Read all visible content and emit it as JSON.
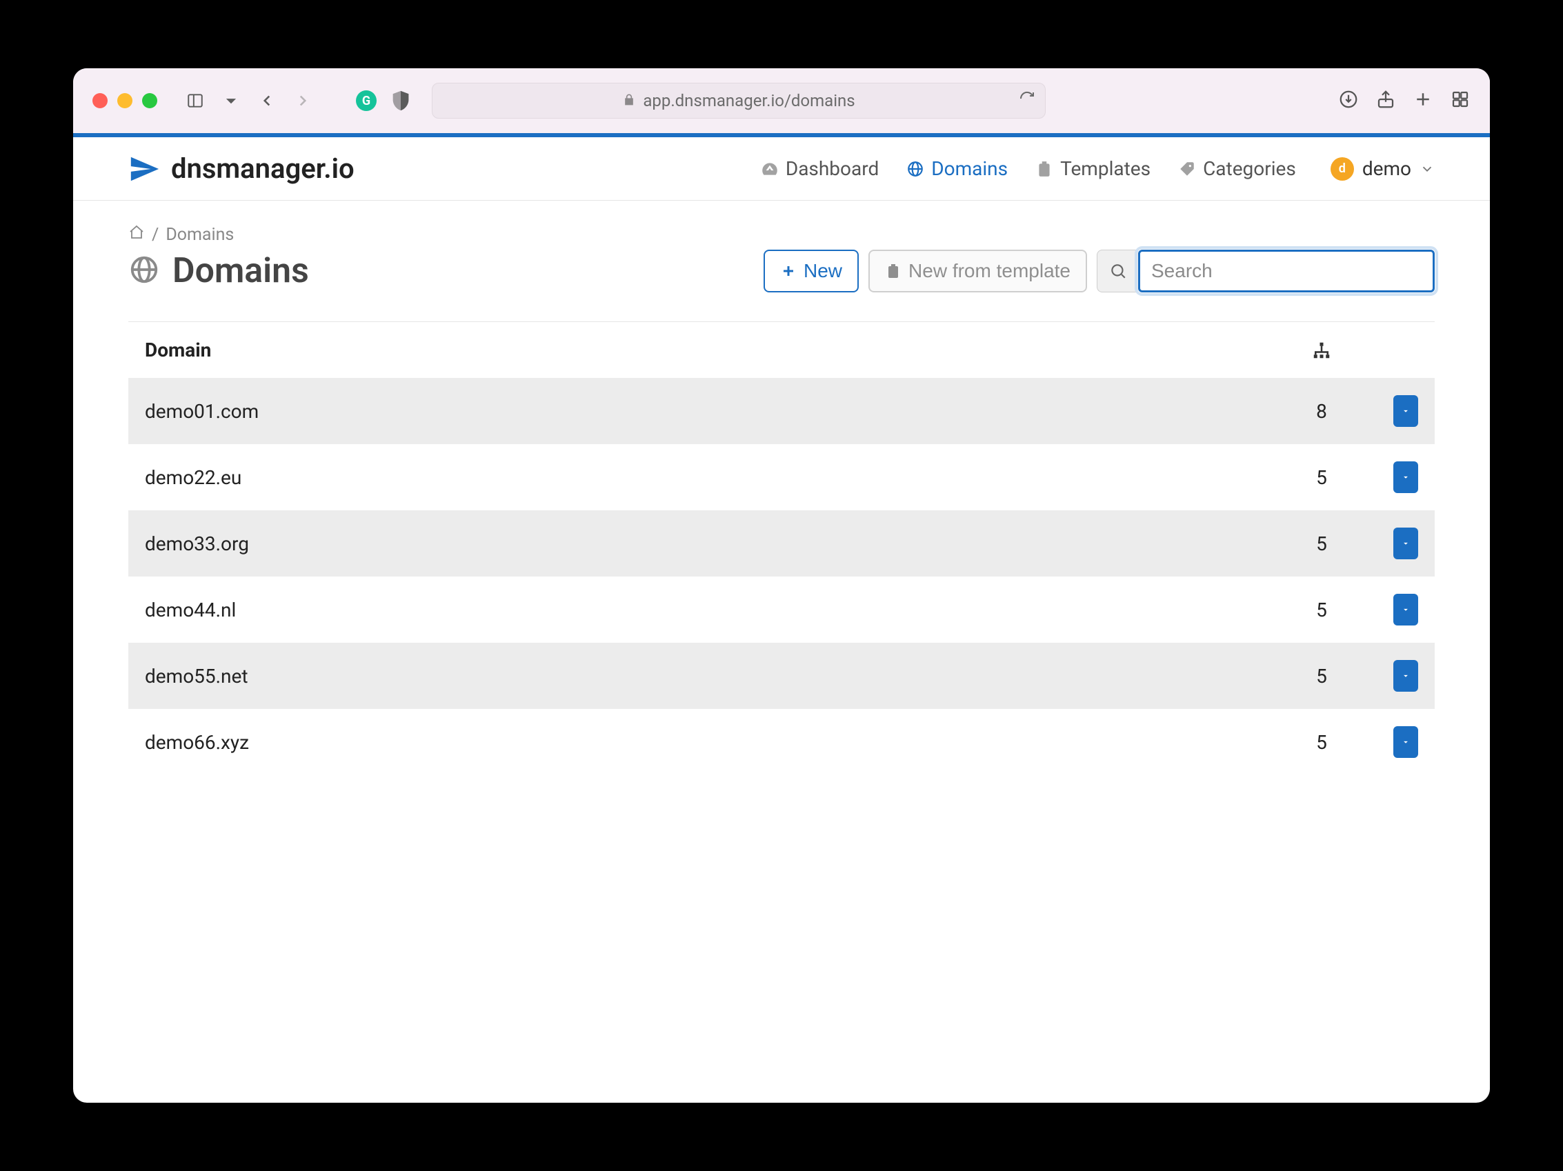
{
  "browser": {
    "url": "app.dnsmanager.io/domains"
  },
  "brand": "dnsmanager.io",
  "nav": {
    "dashboard": "Dashboard",
    "domains": "Domains",
    "templates": "Templates",
    "categories": "Categories"
  },
  "user": {
    "initial": "d",
    "name": "demo"
  },
  "breadcrumb": {
    "sep": "/",
    "current": "Domains"
  },
  "page": {
    "title": "Domains"
  },
  "actions": {
    "new": "New",
    "new_from_template": "New from template"
  },
  "search": {
    "placeholder": "Search",
    "value": ""
  },
  "table": {
    "header": {
      "domain": "Domain"
    },
    "rows": [
      {
        "domain": "demo01.com",
        "records": "8"
      },
      {
        "domain": "demo22.eu",
        "records": "5"
      },
      {
        "domain": "demo33.org",
        "records": "5"
      },
      {
        "domain": "demo44.nl",
        "records": "5"
      },
      {
        "domain": "demo55.net",
        "records": "5"
      },
      {
        "domain": "demo66.xyz",
        "records": "5"
      }
    ]
  }
}
